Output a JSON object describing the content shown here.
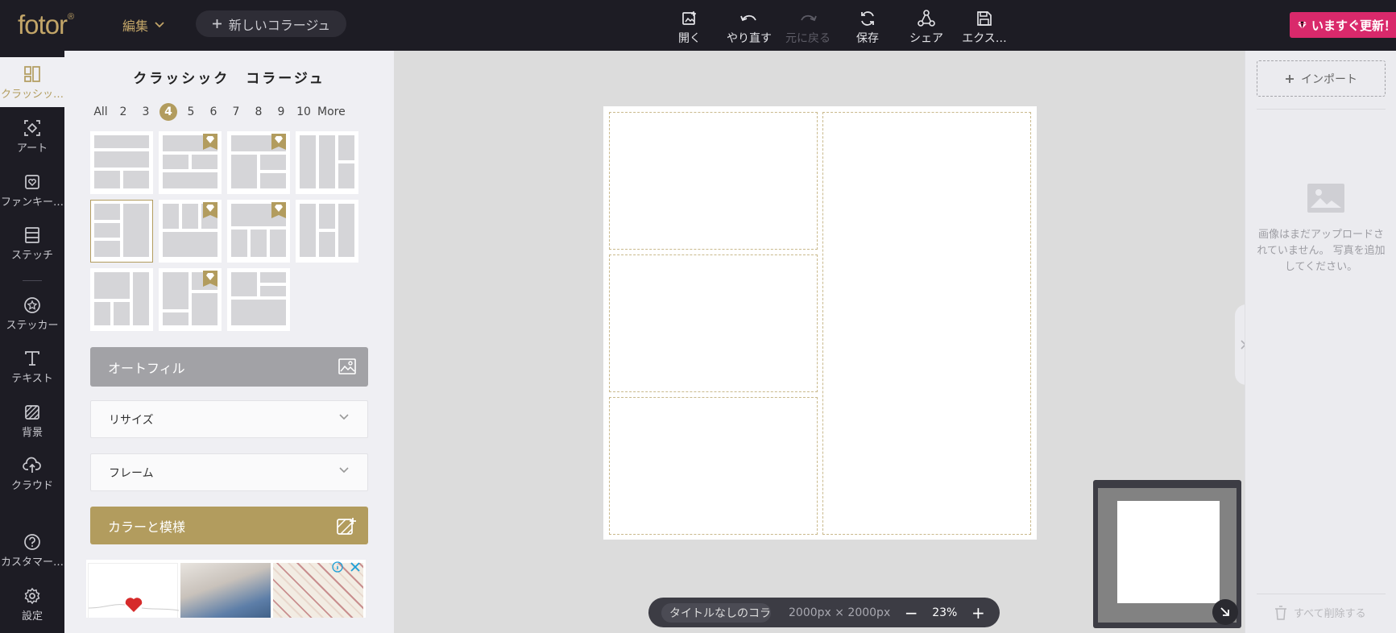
{
  "app": {
    "logo": "fotor",
    "logo_mark": "®"
  },
  "topbar": {
    "edit_menu": "編集",
    "new_collage": "新しいコラージュ",
    "tools": [
      {
        "label": "開く",
        "icon": "open-image-icon",
        "enabled": true
      },
      {
        "label": "やり直す",
        "icon": "undo-icon",
        "enabled": true
      },
      {
        "label": "元に戻る",
        "icon": "redo-icon",
        "enabled": false
      },
      {
        "label": "保存",
        "icon": "refresh-save-icon",
        "enabled": true
      },
      {
        "label": "シェア",
        "icon": "share-icon",
        "enabled": true
      },
      {
        "label": "エクス…",
        "icon": "export-icon",
        "enabled": true
      }
    ],
    "upgrade": "いますぐ更新！"
  },
  "leftnav": {
    "items": [
      {
        "label": "クラッシッ…",
        "icon": "classic-collage-icon",
        "active": true
      },
      {
        "label": "アート",
        "icon": "art-collage-icon"
      },
      {
        "label": "ファンキー…",
        "icon": "funky-collage-icon"
      },
      {
        "label": "ステッチ",
        "icon": "stitch-icon"
      },
      {
        "label": "ステッカー",
        "icon": "sticker-icon"
      },
      {
        "label": "テキスト",
        "icon": "text-icon"
      },
      {
        "label": "背景",
        "icon": "background-icon"
      },
      {
        "label": "クラウド",
        "icon": "cloud-upload-icon"
      },
      {
        "label": "カスタマー…",
        "icon": "help-icon"
      },
      {
        "label": "設定",
        "icon": "settings-gear-icon"
      }
    ]
  },
  "panel": {
    "title": "クラッシック　コラージュ",
    "counts": [
      "All",
      "2",
      "3",
      "4",
      "5",
      "6",
      "7",
      "8",
      "9",
      "10",
      "More"
    ],
    "selected_count": "4",
    "autofill": "オートフィル",
    "resize": "リサイズ",
    "frame": "フレーム",
    "color_pattern": "カラーと模様"
  },
  "canvas": {
    "doc_title": "タイトルなしのコラージュ",
    "dimensions": "2000px × 2000px",
    "zoom": "23%"
  },
  "rightpanel": {
    "import": "インポート",
    "empty_message": "画像はまだアップロードされていません。 写真を追加してください。",
    "delete_all": "すべて削除する"
  },
  "colors": {
    "accent": "#b29c5e",
    "topbar": "#1d1c24",
    "upgrade": "#d9296b"
  }
}
